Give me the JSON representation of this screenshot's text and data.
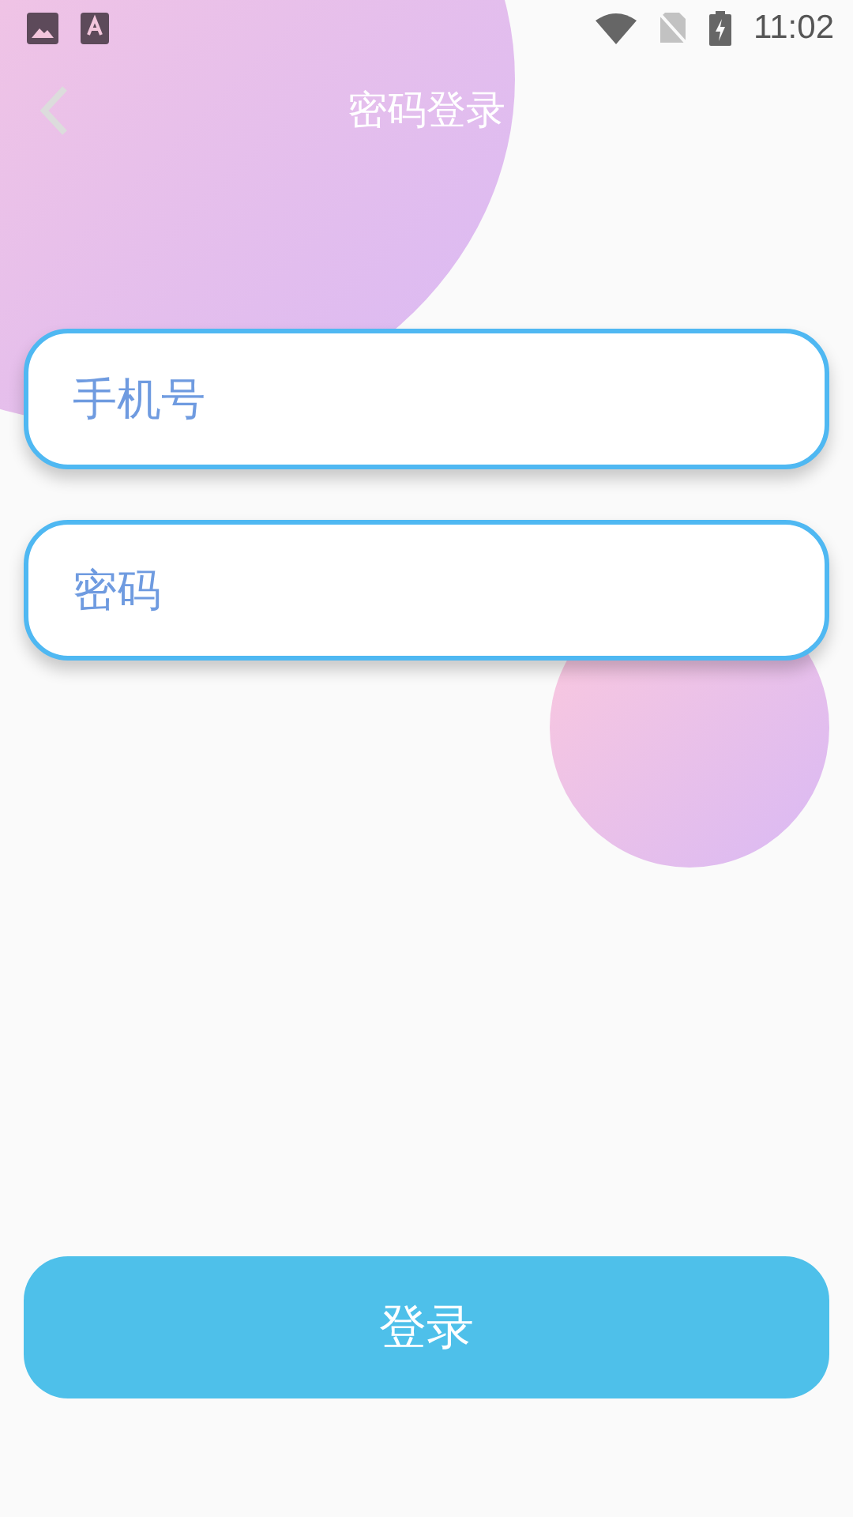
{
  "status_bar": {
    "time": "11:02"
  },
  "header": {
    "title": "密码登录"
  },
  "fields": [
    {
      "placeholder": "手机号"
    },
    {
      "placeholder": "密码"
    }
  ],
  "login_button": {
    "label": "登录"
  }
}
